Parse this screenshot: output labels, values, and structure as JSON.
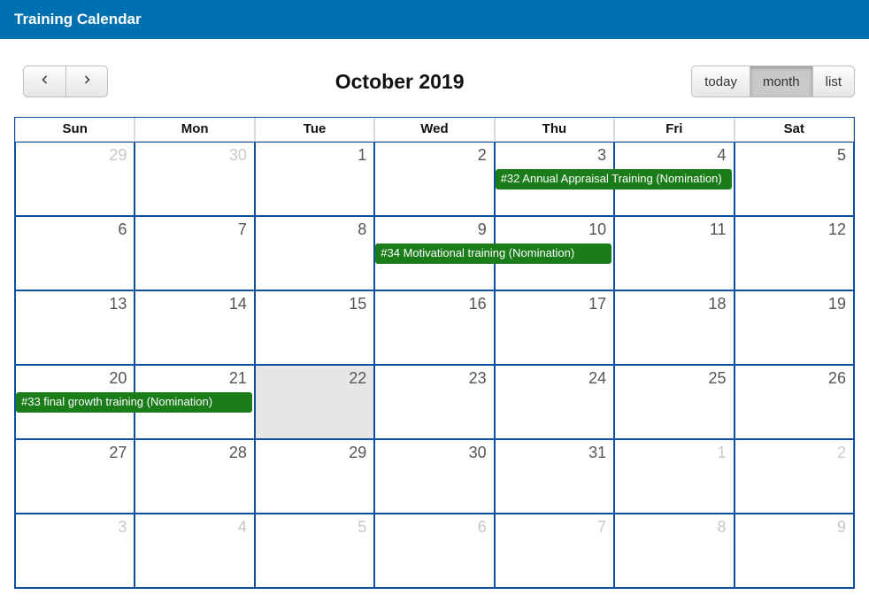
{
  "header": {
    "title": "Training Calendar"
  },
  "toolbar": {
    "title": "October 2019",
    "views": {
      "today": "today",
      "month": "month",
      "list": "list",
      "active": "month"
    }
  },
  "dayHeaders": [
    "Sun",
    "Mon",
    "Tue",
    "Wed",
    "Thu",
    "Fri",
    "Sat"
  ],
  "weeks": [
    [
      {
        "n": "29",
        "other": true
      },
      {
        "n": "30",
        "other": true
      },
      {
        "n": "1"
      },
      {
        "n": "2"
      },
      {
        "n": "3"
      },
      {
        "n": "4"
      },
      {
        "n": "5"
      }
    ],
    [
      {
        "n": "6"
      },
      {
        "n": "7"
      },
      {
        "n": "8"
      },
      {
        "n": "9"
      },
      {
        "n": "10"
      },
      {
        "n": "11"
      },
      {
        "n": "12"
      }
    ],
    [
      {
        "n": "13"
      },
      {
        "n": "14"
      },
      {
        "n": "15"
      },
      {
        "n": "16"
      },
      {
        "n": "17"
      },
      {
        "n": "18"
      },
      {
        "n": "19"
      }
    ],
    [
      {
        "n": "20"
      },
      {
        "n": "21"
      },
      {
        "n": "22",
        "today": true
      },
      {
        "n": "23"
      },
      {
        "n": "24"
      },
      {
        "n": "25"
      },
      {
        "n": "26"
      }
    ],
    [
      {
        "n": "27"
      },
      {
        "n": "28"
      },
      {
        "n": "29"
      },
      {
        "n": "30"
      },
      {
        "n": "31"
      },
      {
        "n": "1",
        "other": true
      },
      {
        "n": "2",
        "other": true
      }
    ],
    [
      {
        "n": "3",
        "other": true
      },
      {
        "n": "4",
        "other": true
      },
      {
        "n": "5",
        "other": true
      },
      {
        "n": "6",
        "other": true
      },
      {
        "n": "7",
        "other": true
      },
      {
        "n": "8",
        "other": true
      },
      {
        "n": "9",
        "other": true
      }
    ]
  ],
  "events": [
    {
      "row": 0,
      "startCol": 4,
      "span": 2,
      "label": "#32 Annual Appraisal Training (Nomination)"
    },
    {
      "row": 1,
      "startCol": 3,
      "span": 2,
      "label": "#34 Motivational training (Nomination)"
    },
    {
      "row": 3,
      "startCol": 0,
      "span": 2,
      "label": "#33 final growth training (Nomination)"
    }
  ],
  "colors": {
    "brand": "#0071b0",
    "gridBorder": "#0a4fa0",
    "event": "#1a7d1a"
  }
}
